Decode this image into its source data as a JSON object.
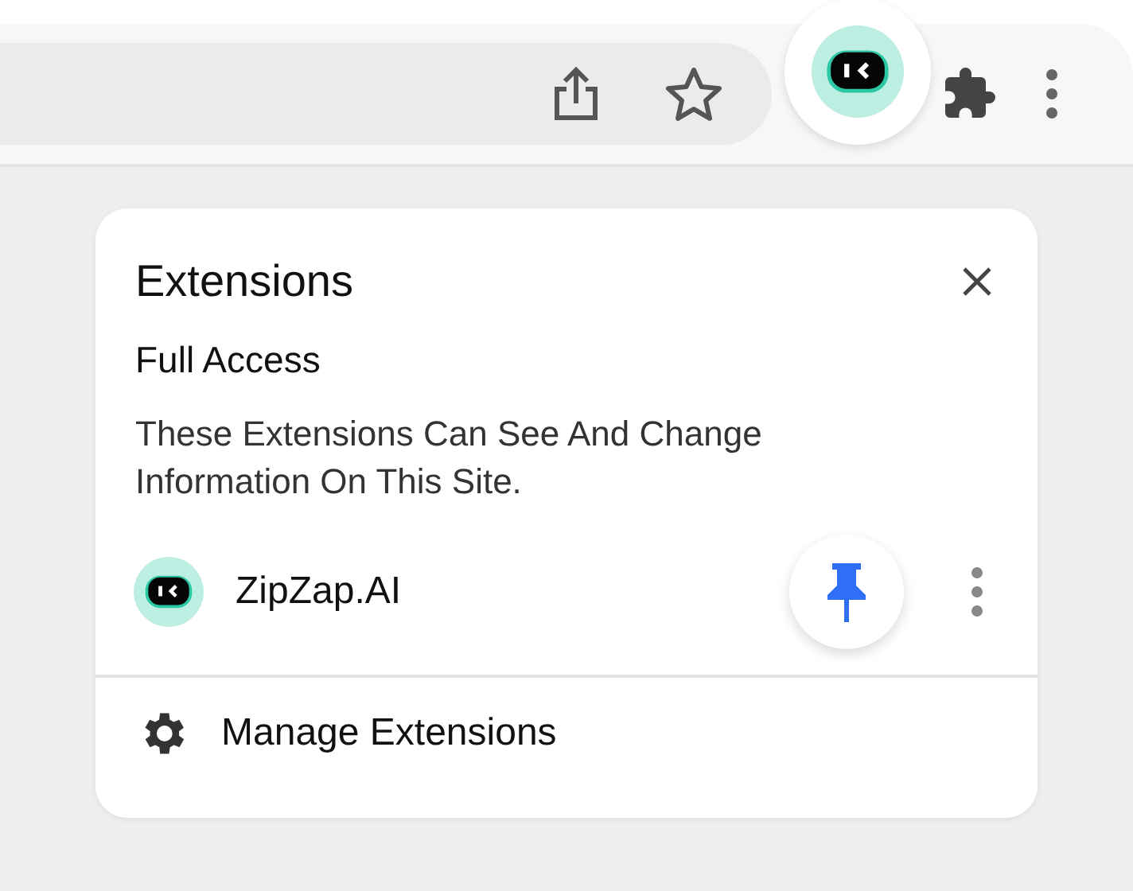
{
  "toolbar": {
    "extension_active": true
  },
  "popup": {
    "title": "Extensions",
    "section_title": "Full Access",
    "description": "These Extensions Can See And Change Information On This Site.",
    "extensions": [
      {
        "name": "ZipZap.AI",
        "pinned": true
      }
    ],
    "manage_label": "Manage Extensions"
  }
}
